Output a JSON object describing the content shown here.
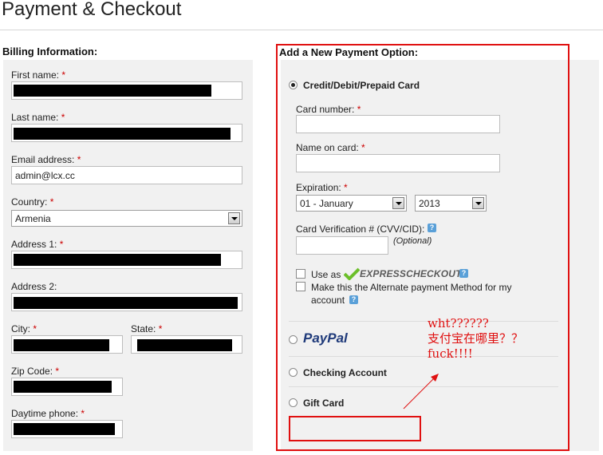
{
  "page": {
    "title": "Payment & Checkout"
  },
  "billing": {
    "heading": "Billing Information:",
    "required_mark": "*",
    "first_name_label": "First name:",
    "last_name_label": "Last name:",
    "email_label": "Email address:",
    "email_value": "admin@lcx.cc",
    "country_label": "Country:",
    "country_value": "Armenia",
    "address1_label": "Address 1:",
    "address2_label": "Address 2:",
    "city_label": "City:",
    "state_label": "State:",
    "zip_label": "Zip Code:",
    "phone_label": "Daytime phone:"
  },
  "payment": {
    "heading": "Add a New Payment Option:",
    "credit_label": "Credit/Debit/Prepaid Card",
    "card_number_label": "Card number:",
    "name_on_card_label": "Name on card:",
    "expiration_label": "Expiration:",
    "exp_month_value": "01 - January",
    "exp_year_value": "2013",
    "cvv_label": "Card Verification # (CVV/CID):",
    "cvv_optional": "(Optional)",
    "use_as_label": "Use as",
    "express_logo": "EXPRESSCHECKOUT",
    "alternate_label_1": "Make this the Alternate payment Method for my",
    "alternate_label_2": "account",
    "paypal_label": "PayPal",
    "checking_label": "Checking Account",
    "gift_label": "Gift Card",
    "help_glyph": "?"
  },
  "annotation": {
    "line1": "wht??????",
    "line2": "支付宝在哪里？？",
    "line3": "fuck!!!!"
  },
  "colors": {
    "annotation": "#e01010",
    "required": "#cc0000",
    "panel": "#f1f1f1"
  }
}
